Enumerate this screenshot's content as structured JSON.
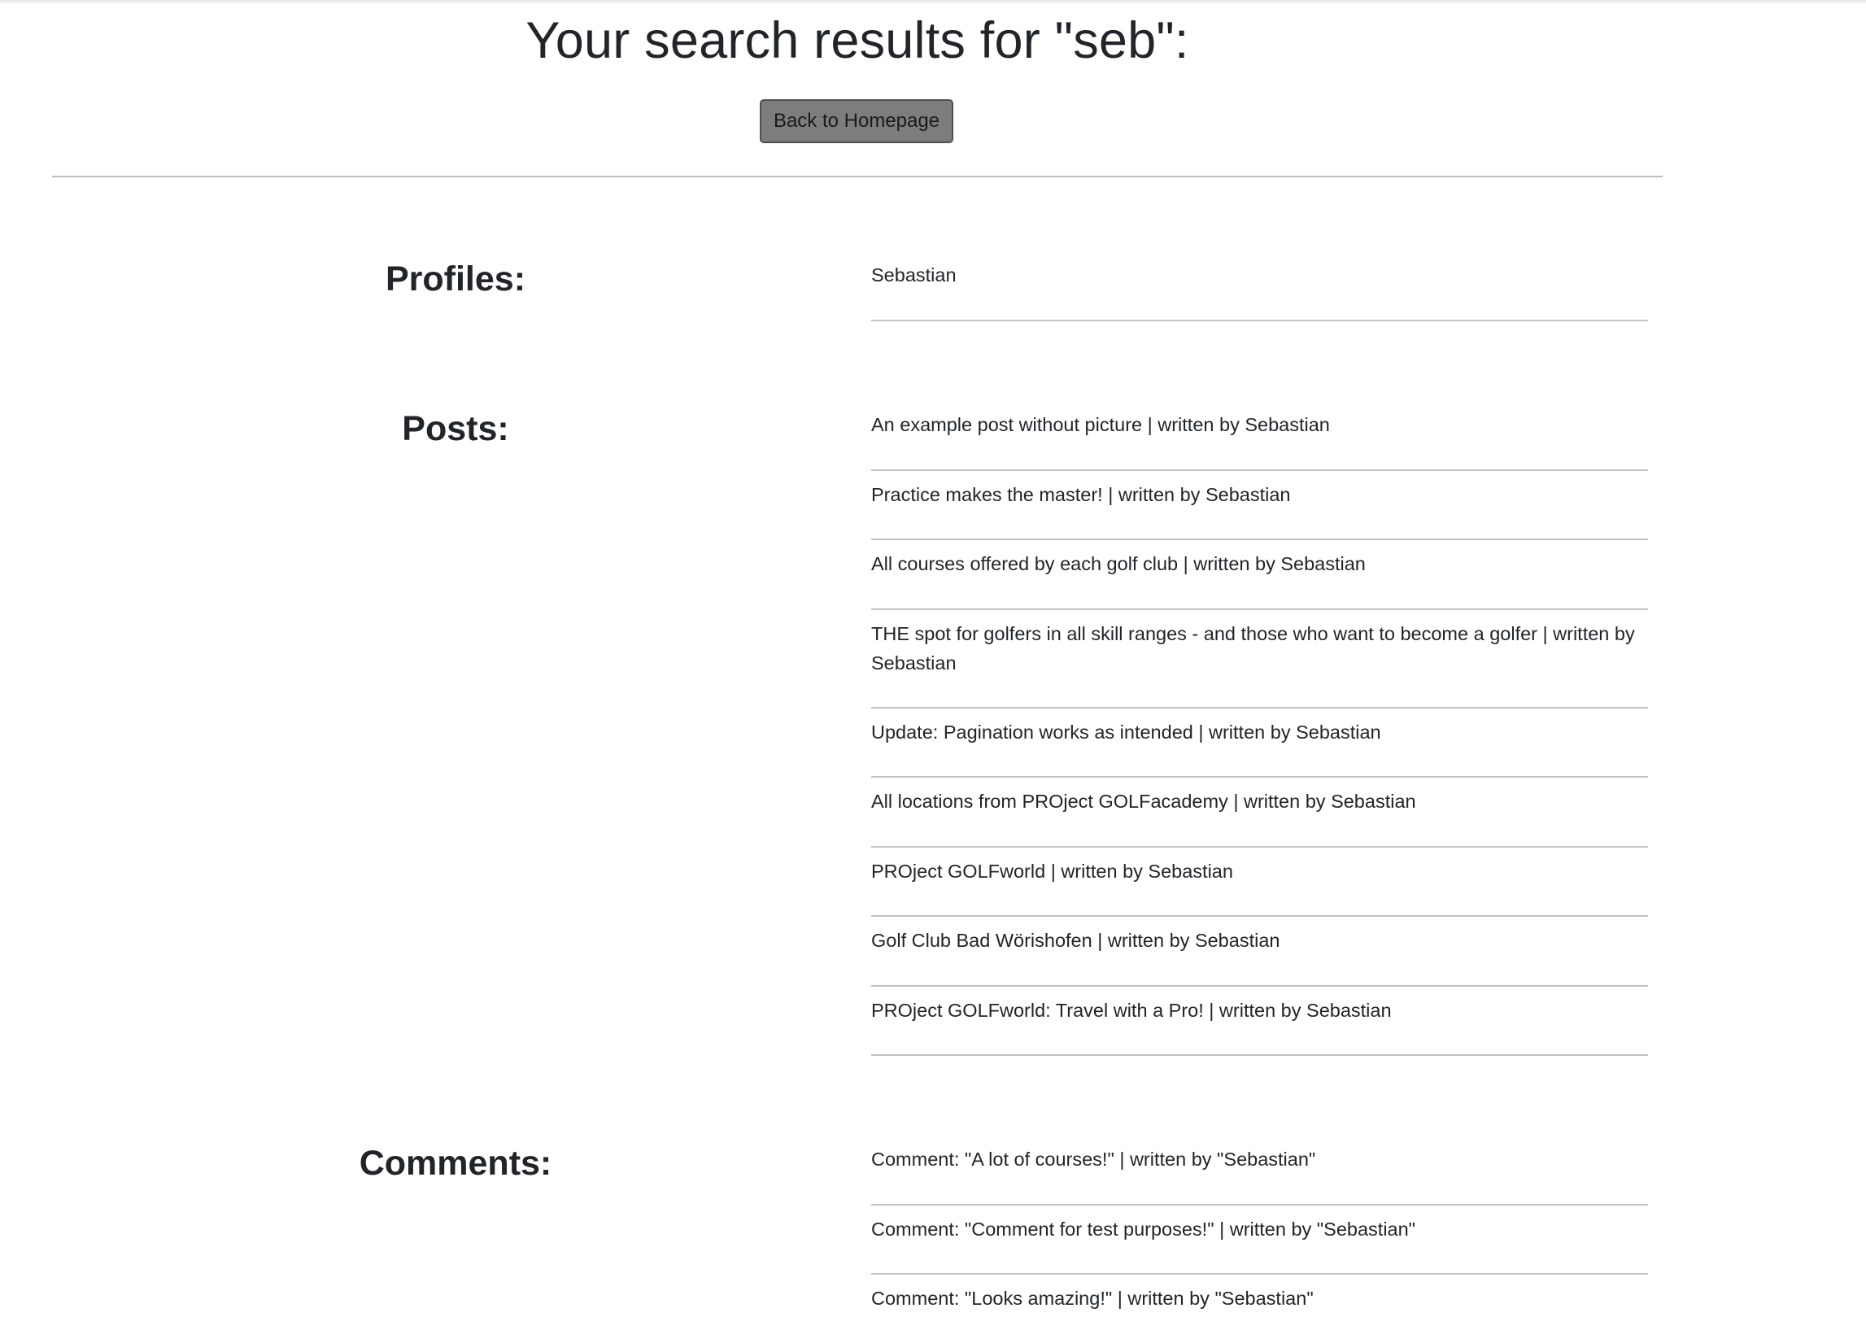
{
  "header": {
    "title": "Your search results for \"seb\":",
    "back_button_label": "Back to Homepage"
  },
  "sections": {
    "profiles": {
      "heading": "Profiles:",
      "items": [
        "Sebastian"
      ]
    },
    "posts": {
      "heading": "Posts:",
      "items": [
        "An example post without picture | written by Sebastian",
        "Practice makes the master! | written by Sebastian",
        "All courses offered by each golf club | written by Sebastian",
        "THE spot for golfers in all skill ranges - and those who want to become a golfer | written by Sebastian",
        "Update: Pagination works as intended | written by Sebastian",
        "All locations from PROject GOLFacademy | written by Sebastian",
        "PROject GOLFworld | written by Sebastian",
        "Golf Club Bad Wörishofen | written by Sebastian",
        "PROject GOLFworld: Travel with a Pro! | written by Sebastian"
      ]
    },
    "comments": {
      "heading": "Comments:",
      "items": [
        "Comment: \"A lot of courses!\" | written by \"Sebastian\"",
        "Comment: \"Comment for test purposes!\" | written by \"Sebastian\"",
        "Comment: \"Looks amazing!\" | written by \"Sebastian\""
      ]
    }
  }
}
